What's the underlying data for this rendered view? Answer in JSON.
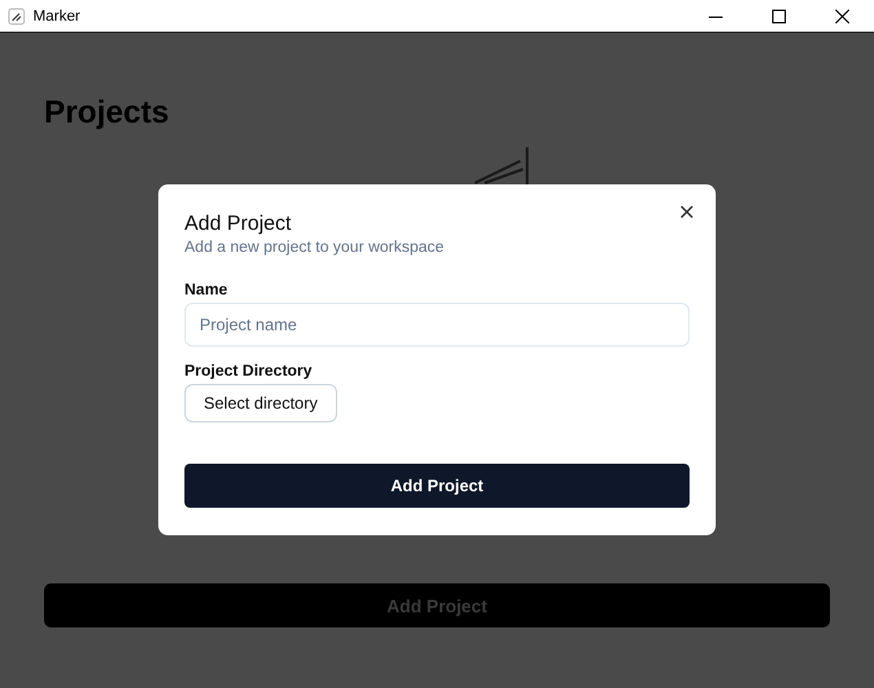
{
  "window": {
    "title": "Marker"
  },
  "page": {
    "title": "Projects",
    "add_button": "Add Project"
  },
  "dialog": {
    "title": "Add Project",
    "description": "Add a new project to your workspace",
    "name_label": "Name",
    "name_placeholder": "Project name",
    "directory_label": "Project Directory",
    "directory_button": "Select directory",
    "submit": "Add Project"
  }
}
